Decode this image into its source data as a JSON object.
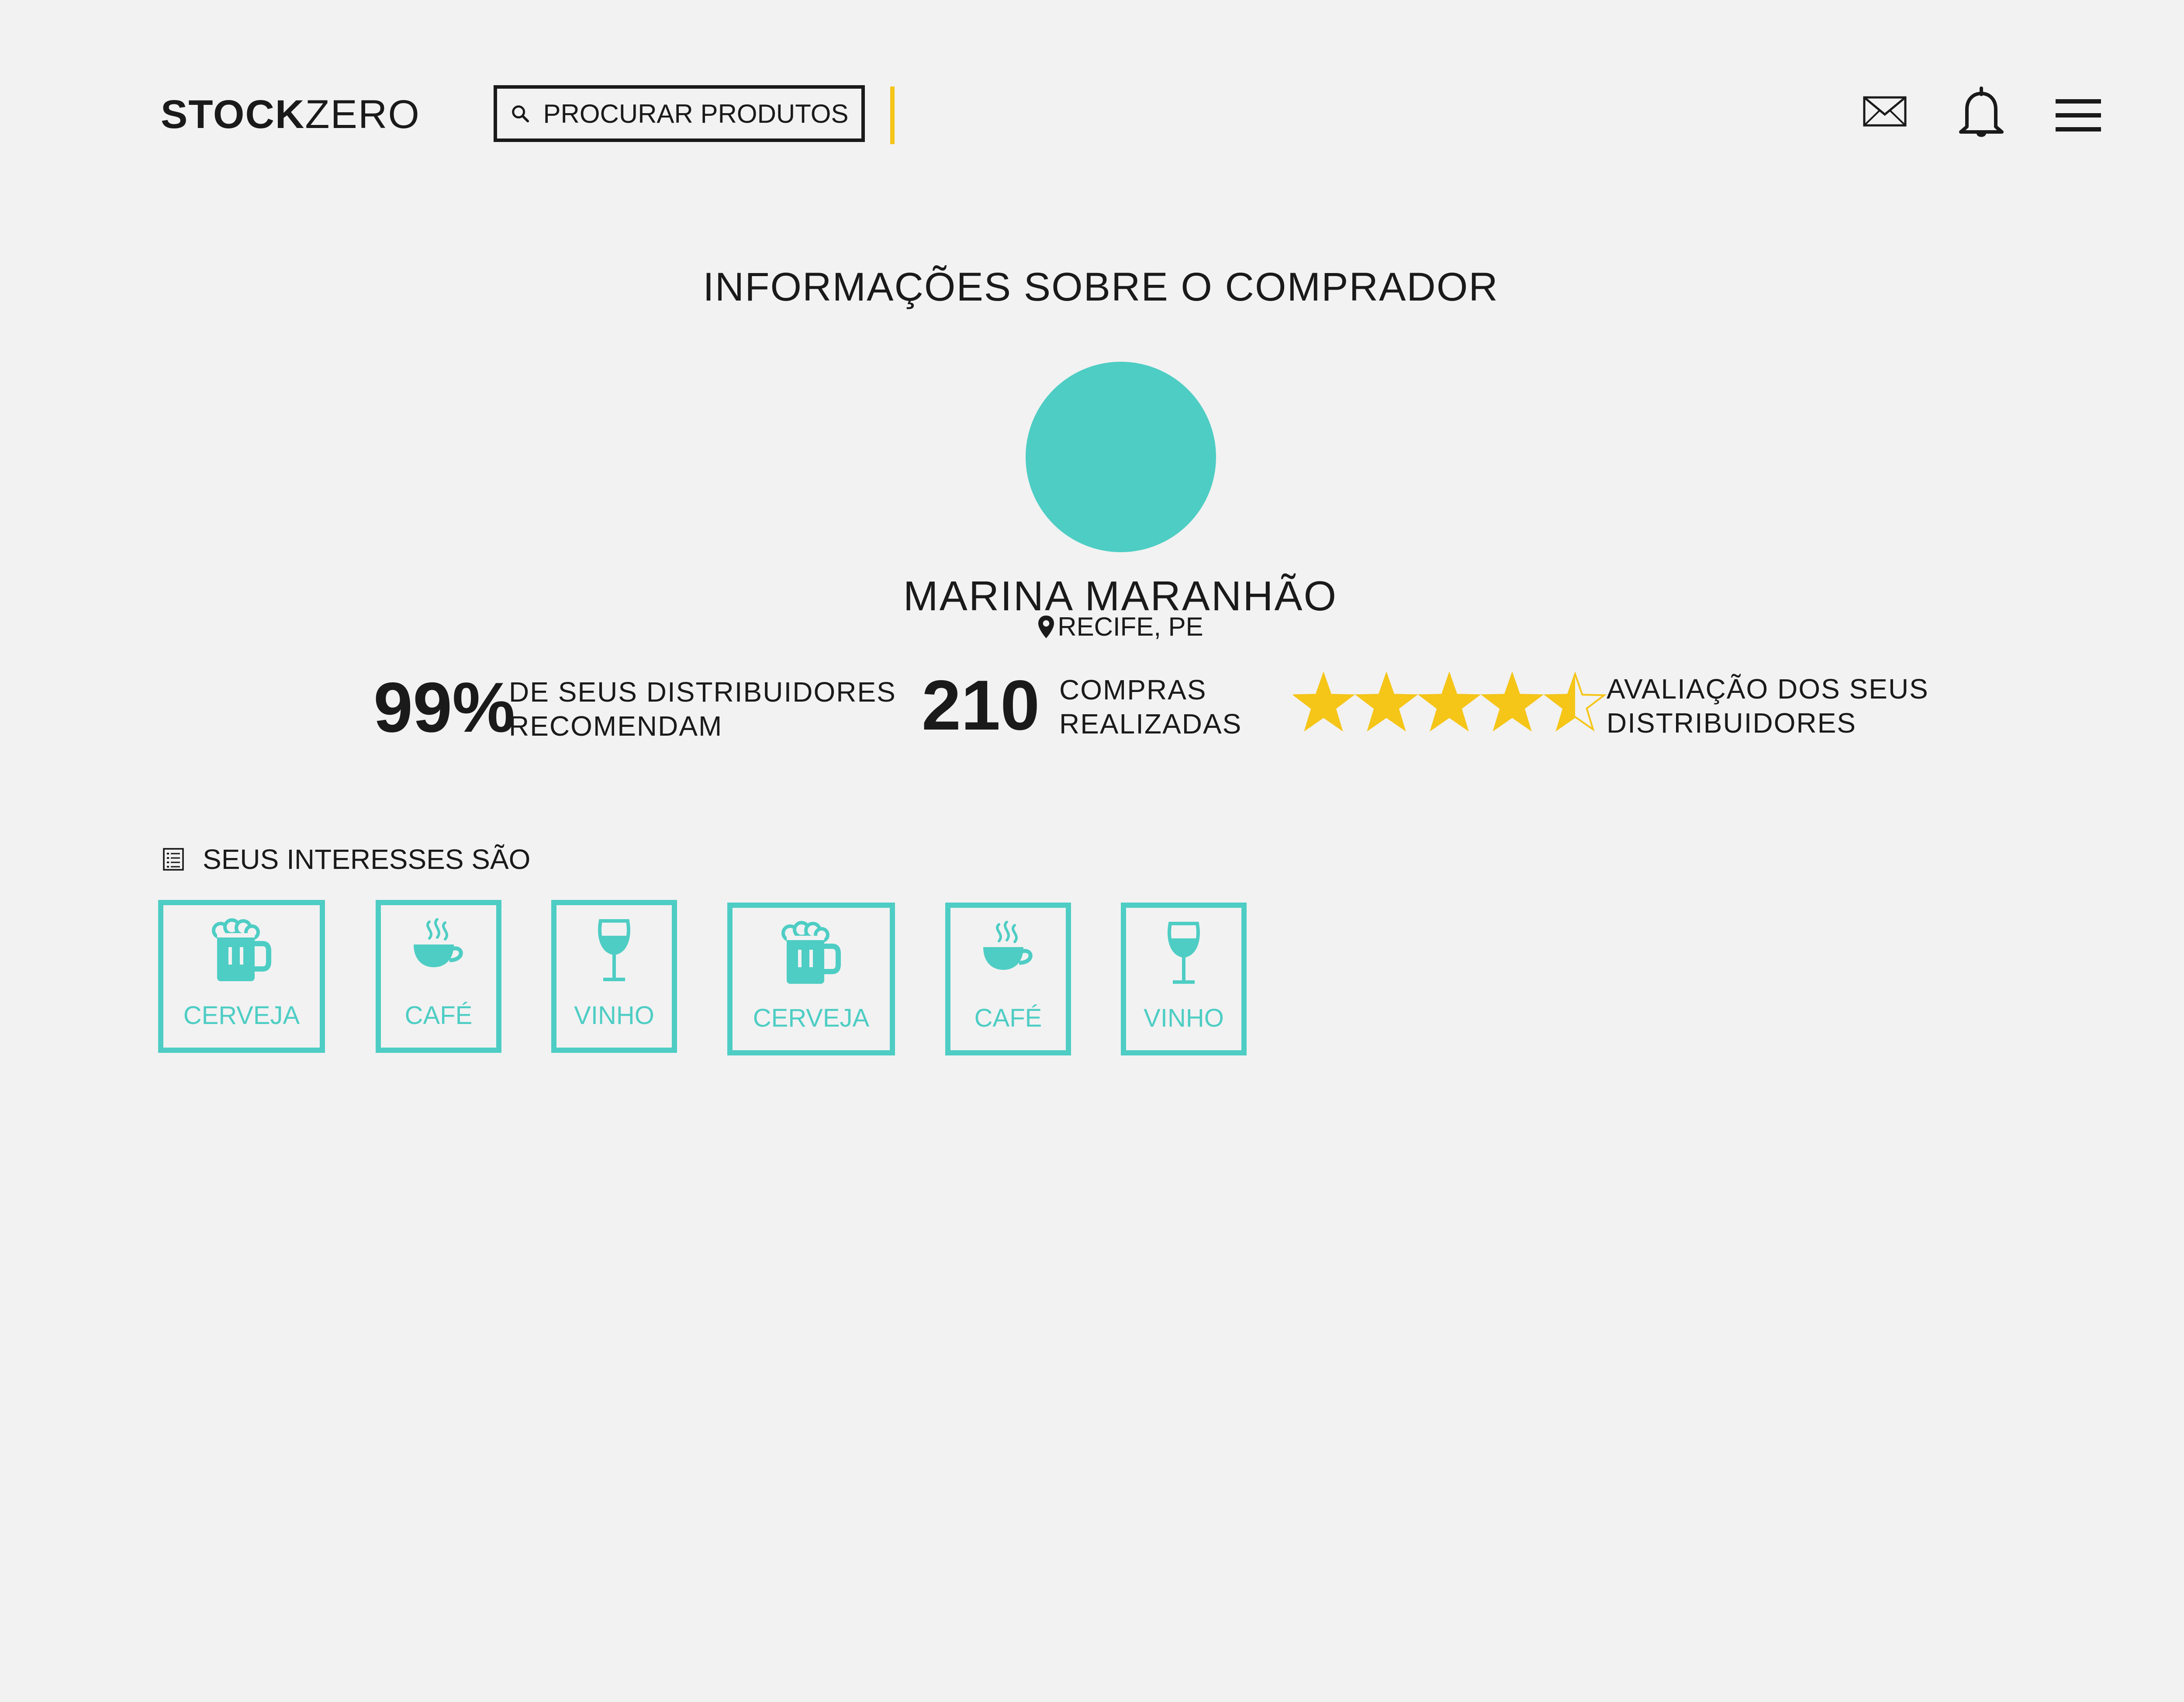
{
  "header": {
    "logo_bold": "STOCK",
    "logo_light": "ZERO",
    "search_label": "PROCURAR PRODUTOS",
    "icons": [
      "search-icon",
      "mail-icon",
      "bell-icon",
      "menu-icon"
    ]
  },
  "page": {
    "title": "INFORMAÇÕES SOBRE O COMPRADOR"
  },
  "buyer": {
    "name": "MARINA MARANHÃO",
    "location": "RECIFE, PE"
  },
  "stats": {
    "recommend_value": "99%",
    "recommend_label_line1": "DE SEUS DISTRIBUIDORES",
    "recommend_label_line2": "RECOMENDAM",
    "purchases_value": "210",
    "purchases_label_line1": "COMPRAS",
    "purchases_label_line2": "REALIZADAS",
    "rating_value": 4.5,
    "rating_max": 5,
    "rating_label_line1": "AVALIAÇÃO DOS SEUS",
    "rating_label_line2": "DISTRIBUIDORES"
  },
  "interests": {
    "title": "SEUS INTERESSES SÃO",
    "items": [
      {
        "label": "CERVEJA",
        "icon": "beer-icon"
      },
      {
        "label": "CAFÉ",
        "icon": "coffee-icon"
      },
      {
        "label": "VINHO",
        "icon": "wine-icon"
      },
      {
        "label": "CERVEJA",
        "icon": "beer-icon"
      },
      {
        "label": "CAFÉ",
        "icon": "coffee-icon"
      },
      {
        "label": "VINHO",
        "icon": "wine-icon"
      }
    ]
  },
  "colors": {
    "background": "#f2f2f2",
    "text": "#1a1a1a",
    "accent_teal": "#4ecdc4",
    "accent_yellow": "#f5c518"
  }
}
